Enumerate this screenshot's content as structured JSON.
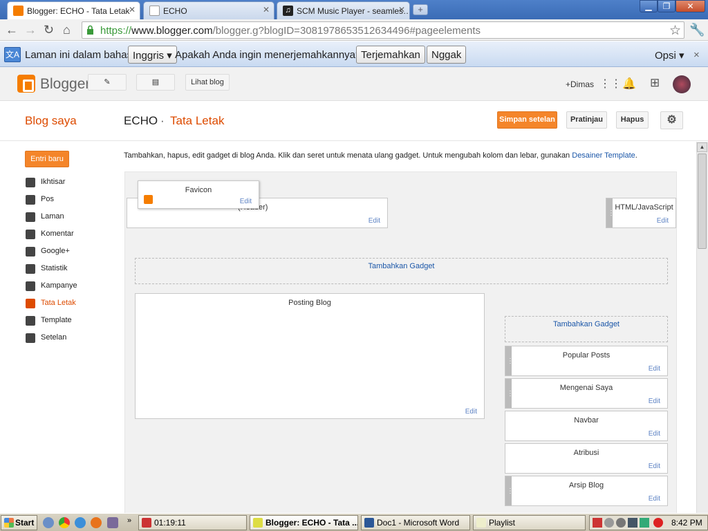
{
  "browser": {
    "tabs": [
      {
        "label": "Blogger: ECHO - Tata Letak",
        "icon": "blogger-icon"
      },
      {
        "label": "ECHO",
        "icon": "page-icon"
      },
      {
        "label": "SCM Music Player - seamles…",
        "icon": "music-icon"
      }
    ],
    "new_tab": "+",
    "url_scheme": "https://",
    "url_host": "www.blogger.com",
    "url_path": "/blogger.g?blogID=3081978653512634496#pageelements"
  },
  "translate_bar": {
    "prefix": "Laman ini dalam bahasa",
    "language": "Inggris",
    "question": "Apakah Anda ingin menerjemahkannya?",
    "translate": "Terjemahkan",
    "no": "Nggak",
    "options": "Opsi",
    "close": "×"
  },
  "blogger_header": {
    "brand": "Blogger",
    "view_blog": "Lihat blog",
    "user": "+Dimas"
  },
  "page_header": {
    "my_blogs": "Blog saya",
    "blog_name": "ECHO",
    "separator": "·",
    "section": "Tata Letak",
    "save": "Simpan setelan",
    "preview": "Pratinjau",
    "delete": "Hapus"
  },
  "sidebar": {
    "new_post": "Entri baru",
    "items": [
      {
        "label": "Ikhtisar",
        "icon": "home-icon"
      },
      {
        "label": "Pos",
        "icon": "posts-icon"
      },
      {
        "label": "Laman",
        "icon": "pages-icon"
      },
      {
        "label": "Komentar",
        "icon": "comments-icon"
      },
      {
        "label": "Google+",
        "icon": "google-plus-icon"
      },
      {
        "label": "Statistik",
        "icon": "stats-icon"
      },
      {
        "label": "Kampanye",
        "icon": "campaign-icon"
      },
      {
        "label": "Tata Letak",
        "icon": "layout-icon",
        "active": true
      },
      {
        "label": "Template",
        "icon": "template-icon"
      },
      {
        "label": "Setelan",
        "icon": "settings-wrench-icon"
      }
    ]
  },
  "layout": {
    "intro": "Tambahkan, hapus, edit gadget di blog Anda. Klik dan seret untuk menata ulang gadget. Untuk mengubah kolom dan lebar, gunakan",
    "designer_link": "Desainer Template",
    "intro_end": ".",
    "edit": "Edit",
    "add_gadget": "Tambahkan Gadget",
    "header_gadget": "ECHO (Header)",
    "header_gadget_visible": "(Header)",
    "dragging_gadget": "Favicon",
    "html_gadget": "HTML/JavaScript",
    "posts_gadget": "Posting Blog",
    "sidebar_gadgets": [
      "Popular Posts",
      "Mengenai Saya",
      "Navbar",
      "Atribusi",
      "Arsip Blog"
    ]
  },
  "taskbar": {
    "start": "Start",
    "items": [
      "01:19:11",
      "Blogger: ECHO - Tata ...",
      "Doc1 - Microsoft Word",
      "Playlist"
    ],
    "clock": "8:42 PM"
  },
  "colors": {
    "accent": "#f4852a",
    "link": "#1a56a8",
    "active_nav": "#dd4b00"
  }
}
